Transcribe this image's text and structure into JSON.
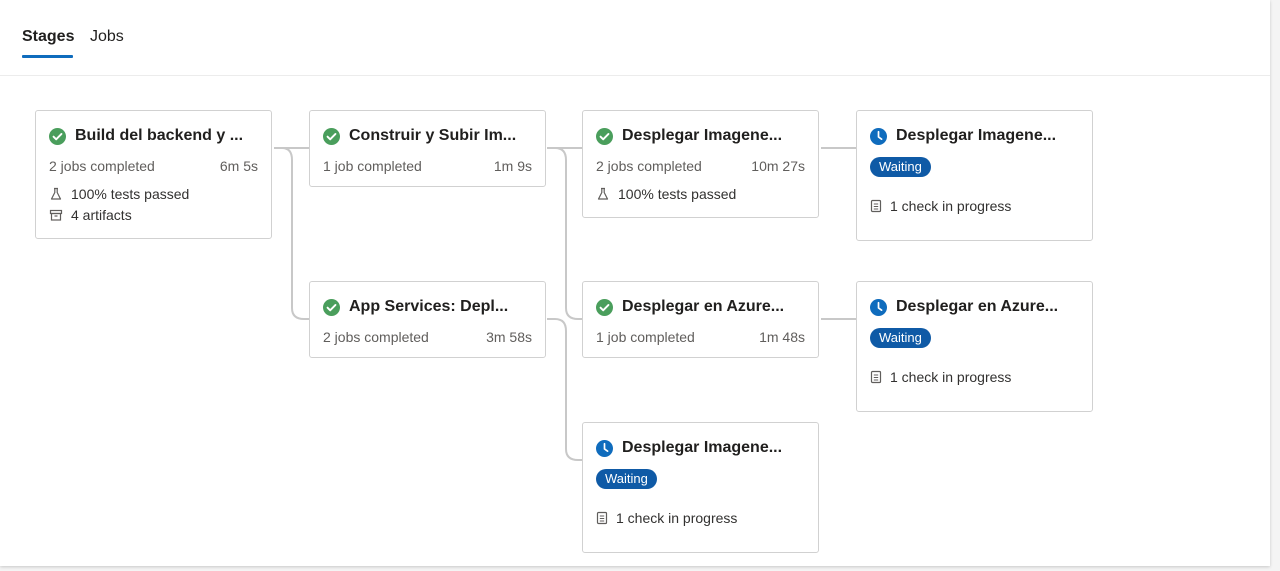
{
  "tabs": [
    {
      "label": "Stages",
      "active": true
    },
    {
      "label": "Jobs",
      "active": false
    }
  ],
  "colors": {
    "success": "#4a9e5c",
    "waiting": "#0f6cbd",
    "badge": "#0f5aa6",
    "tab_accent": "#0f6cbd"
  },
  "stages": [
    {
      "title": "Build del backend y ...",
      "status": "success",
      "jobs": "2 jobs completed",
      "duration": "6m 5s",
      "tests": "100% tests passed",
      "artifacts": "4 artifacts"
    },
    {
      "title": "Construir y Subir Im...",
      "status": "success",
      "jobs": "1 job completed",
      "duration": "1m 9s"
    },
    {
      "title": "App Services: Depl...",
      "status": "success",
      "jobs": "2 jobs completed",
      "duration": "3m 58s"
    },
    {
      "title": "Desplegar Imagene...",
      "status": "success",
      "jobs": "2 jobs completed",
      "duration": "10m 27s",
      "tests": "100% tests passed"
    },
    {
      "title": "Desplegar en Azure...",
      "status": "success",
      "jobs": "1 job completed",
      "duration": "1m 48s"
    },
    {
      "title": "Desplegar Imagene...",
      "status": "waiting",
      "badge": "Waiting",
      "check": "1 check in progress"
    },
    {
      "title": "Desplegar Imagene...",
      "status": "waiting",
      "badge": "Waiting",
      "check": "1 check in progress"
    },
    {
      "title": "Desplegar en Azure...",
      "status": "waiting",
      "badge": "Waiting",
      "check": "1 check in progress"
    }
  ]
}
